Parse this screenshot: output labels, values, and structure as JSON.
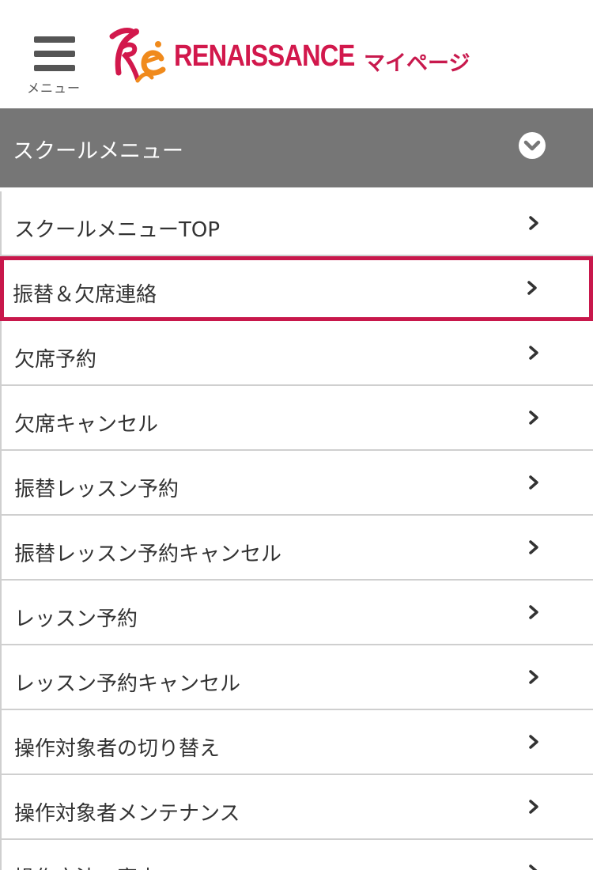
{
  "header": {
    "menu_label": "メニュー",
    "logo_text": "RENAISSANCE",
    "page_title": "マイページ"
  },
  "section": {
    "title": "スクールメニュー"
  },
  "menu": {
    "items": [
      {
        "label": "スクールメニューTOP"
      },
      {
        "label": "振替＆欠席連絡",
        "highlighted": true
      },
      {
        "label": "欠席予約"
      },
      {
        "label": "欠席キャンセル"
      },
      {
        "label": "振替レッスン予約"
      },
      {
        "label": "振替レッスン予約キャンセル"
      },
      {
        "label": "レッスン予約"
      },
      {
        "label": "レッスン予約キャンセル"
      },
      {
        "label": "操作対象者の切り替え"
      },
      {
        "label": "操作対象者メンテナンス"
      },
      {
        "label": "操作方法の案内"
      }
    ]
  },
  "colors": {
    "brand": "#c8194d",
    "section_bar": "#767676",
    "highlight_border": "#c8174b"
  }
}
